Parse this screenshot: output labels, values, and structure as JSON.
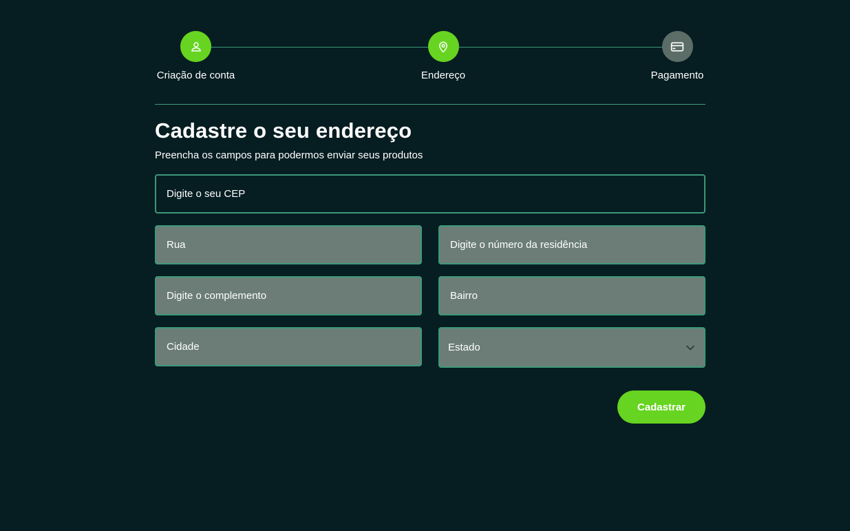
{
  "stepper": {
    "steps": [
      {
        "label": "Criação de conta",
        "icon": "user-icon",
        "status": "done"
      },
      {
        "label": "Endereço",
        "icon": "map-pin-icon",
        "status": "current"
      },
      {
        "label": "Pagamento",
        "icon": "credit-card-icon",
        "status": "pending"
      }
    ]
  },
  "form": {
    "title": "Cadastre o seu endereço",
    "subtitle": "Preencha os campos para podermos enviar seus produtos",
    "cep_placeholder": "Digite o seu CEP",
    "rua_placeholder": "Rua",
    "numero_placeholder": "Digite o número da residência",
    "complemento_placeholder": "Digite o complemento",
    "bairro_placeholder": "Bairro",
    "cidade_placeholder": "Cidade",
    "estado_selected": "Estado",
    "submit_label": "Cadastrar"
  },
  "colors": {
    "background": "#061d22",
    "accent": "#66d421",
    "border": "#3d9978",
    "disabled_field": "#6b7d76",
    "pending_step": "#5c6d68"
  }
}
